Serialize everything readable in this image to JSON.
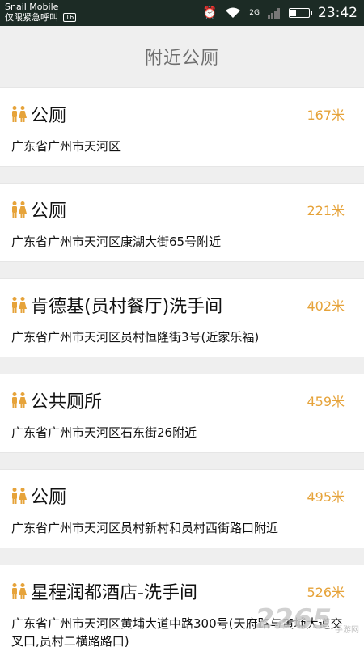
{
  "status_bar": {
    "carrier": "Snail Mobile",
    "emergency": "仅限紧急呼叫",
    "sim_badge": "16",
    "network": "2G",
    "time": "23:42",
    "battery_level": 0.35
  },
  "header": {
    "title": "附近公厕"
  },
  "toilets": [
    {
      "name": "公厕",
      "distance": "167米",
      "address": "广东省广州市天河区"
    },
    {
      "name": "公厕",
      "distance": "221米",
      "address": "广东省广州市天河区康湖大街65号附近"
    },
    {
      "name": "肯德基(员村餐厅)洗手间",
      "distance": "402米",
      "address": "广东省广州市天河区员村恒隆街3号(近家乐福)"
    },
    {
      "name": "公共厕所",
      "distance": "459米",
      "address": "广东省广州市天河区石东街26附近"
    },
    {
      "name": "公厕",
      "distance": "495米",
      "address": "广东省广州市天河区员村新村和员村西街路口附近"
    },
    {
      "name": "星程润都酒店-洗手间",
      "distance": "526米",
      "address": "广东省广州市天河区黄埔大道中路300号(天府路与黄埔大道交叉口,员村二横路路口)"
    }
  ],
  "watermark": {
    "big": "2265",
    "site": "手游网"
  },
  "colors": {
    "accent": "#e6a33a",
    "status_bar_bg": "#1c2b25"
  }
}
